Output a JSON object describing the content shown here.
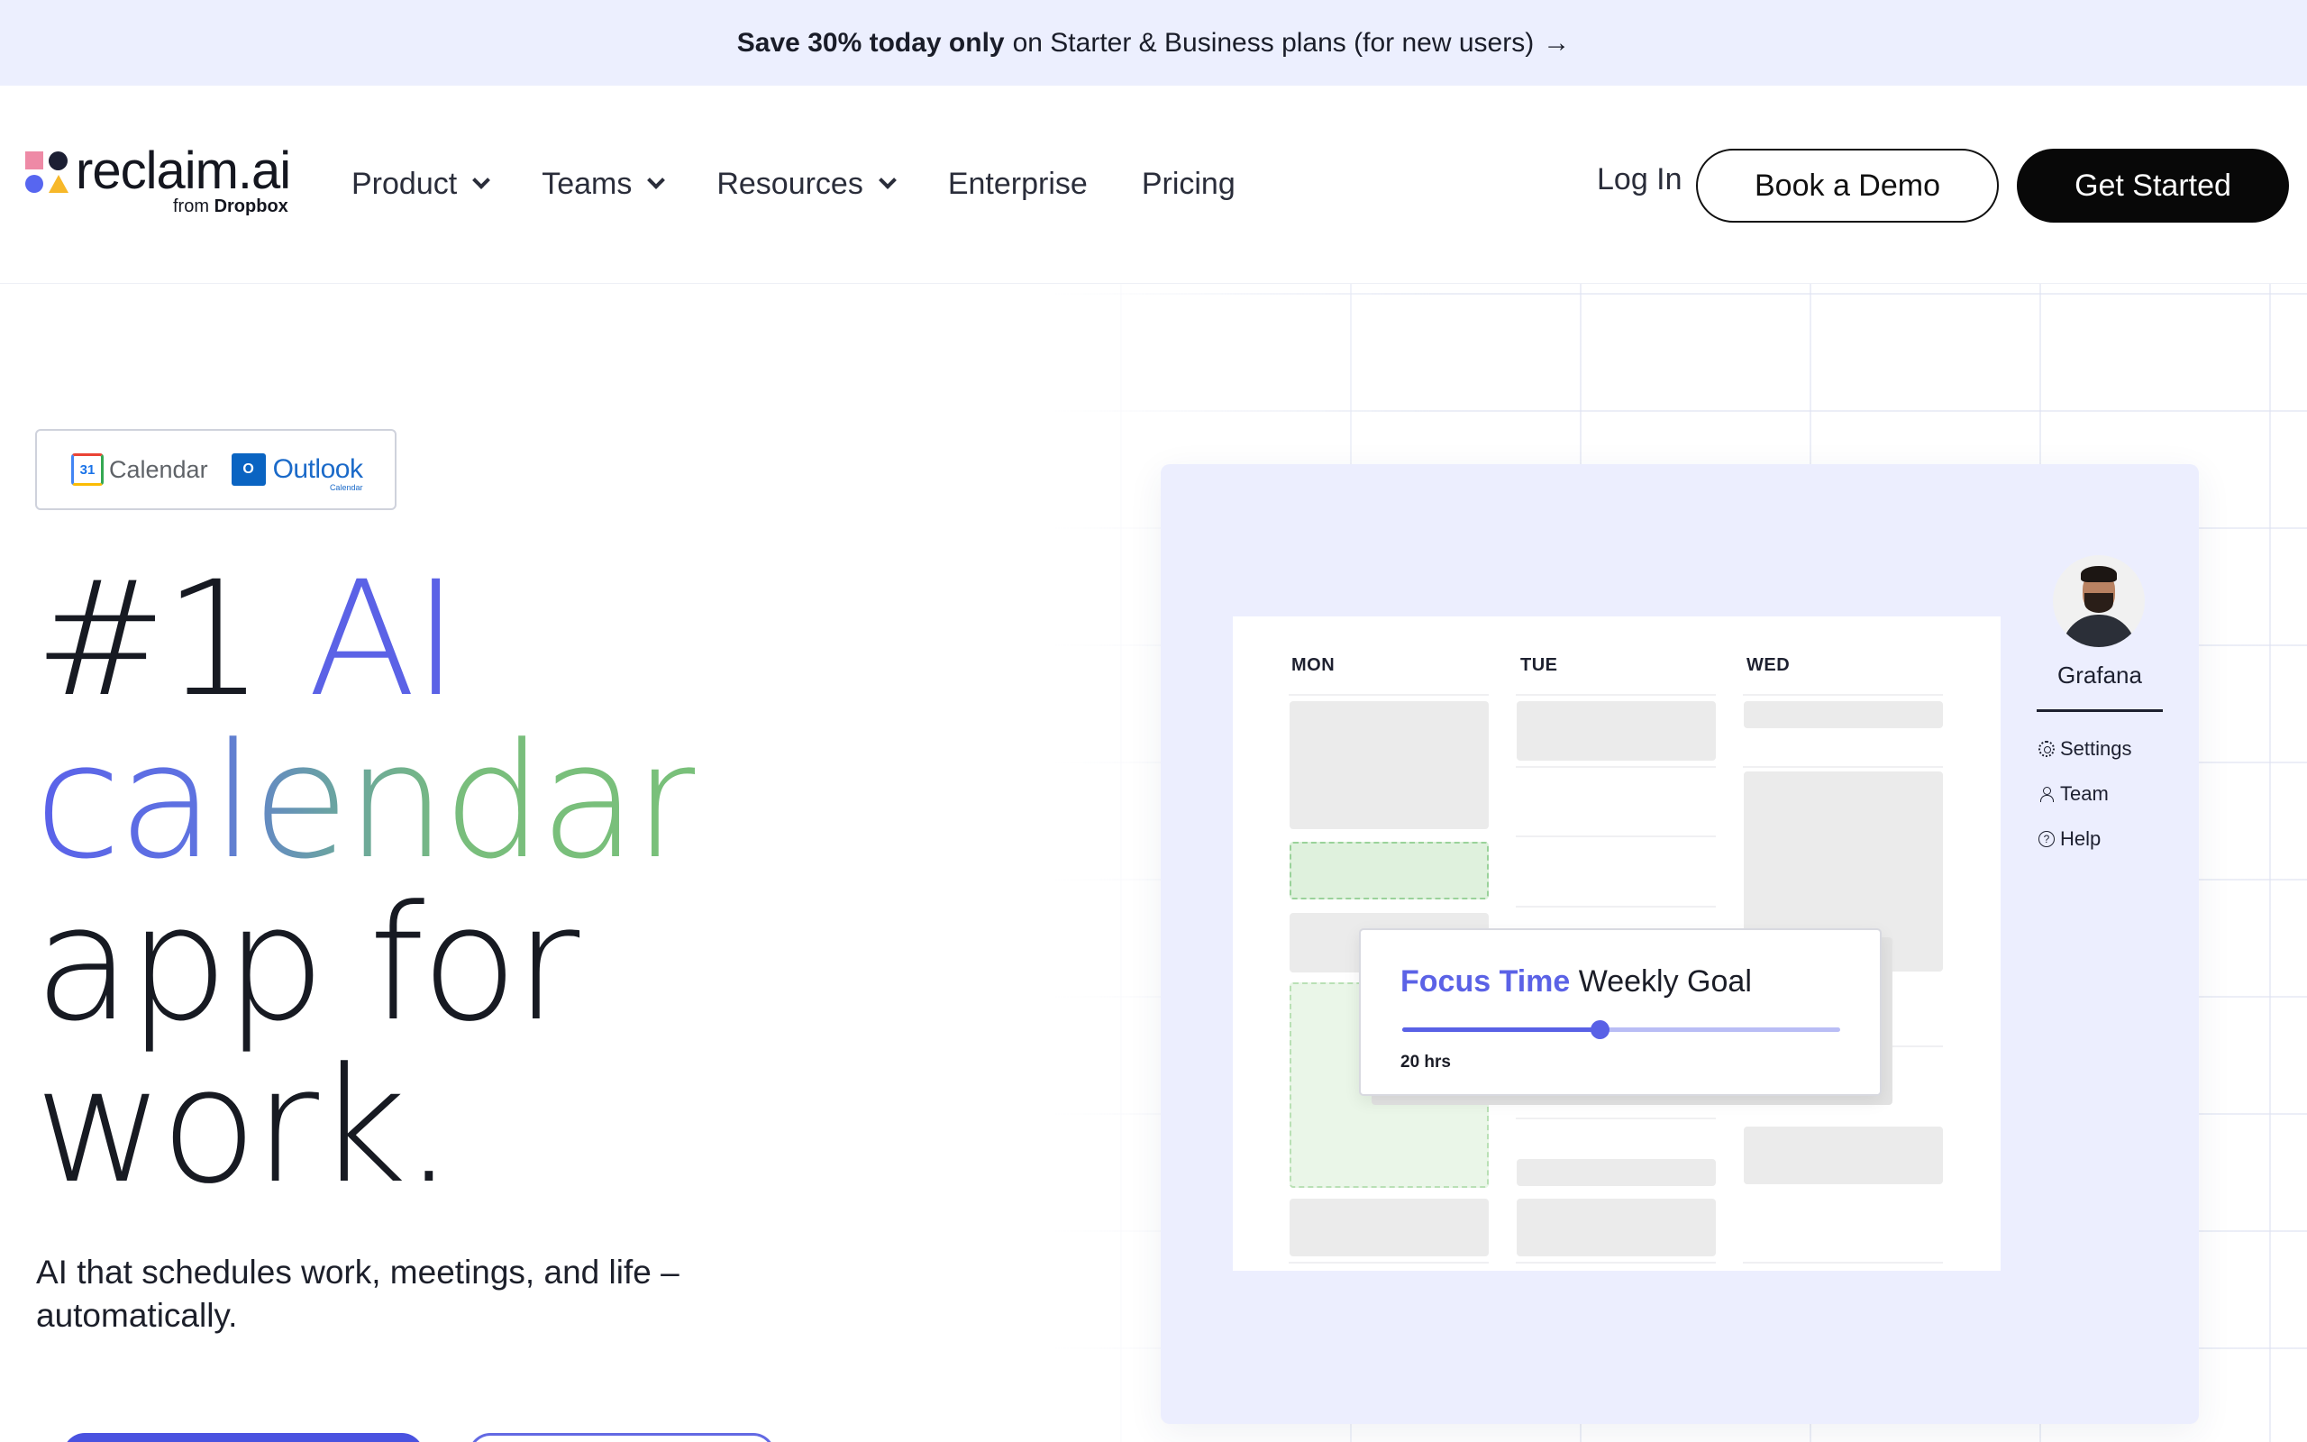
{
  "promo": {
    "bold": "Save 30% today only",
    "text": "on Starter & Business plans (for new users)",
    "arrow": "→"
  },
  "logo": {
    "wordmark": "reclaim.ai",
    "from": "from",
    "partner": "Dropbox"
  },
  "nav": {
    "items": [
      {
        "label": "Product",
        "has_dropdown": true
      },
      {
        "label": "Teams",
        "has_dropdown": true
      },
      {
        "label": "Resources",
        "has_dropdown": true
      },
      {
        "label": "Enterprise",
        "has_dropdown": false
      },
      {
        "label": "Pricing",
        "has_dropdown": false
      }
    ],
    "login": "Log In",
    "demo": "Book a Demo",
    "start": "Get Started"
  },
  "integrations": {
    "google_icon_text": "31",
    "google_label": "Calendar",
    "outlook_icon_text": "O",
    "outlook_label": "Outlook",
    "outlook_sub": "Calendar"
  },
  "hero": {
    "line1_a": "#1",
    "line1_b": "AI",
    "line2": "calendar",
    "line3": "app for",
    "line4": "work.",
    "subhead": "AI that schedules work, meetings, and life – automatically."
  },
  "app_preview": {
    "days": [
      "MON",
      "TUE",
      "WED"
    ],
    "goal": {
      "title_accent": "Focus Time",
      "title_rest": "Weekly Goal",
      "value_label": "20 hrs",
      "progress": 0.45
    },
    "user": {
      "name": "Grafana",
      "links": [
        "Settings",
        "Team",
        "Help"
      ]
    }
  },
  "colors": {
    "promo_bg": "#eceffe",
    "brand_purple": "#5b62e6",
    "brand_green": "#79c07a",
    "panel_bg": "#eceefe",
    "button_dark": "#080808"
  }
}
